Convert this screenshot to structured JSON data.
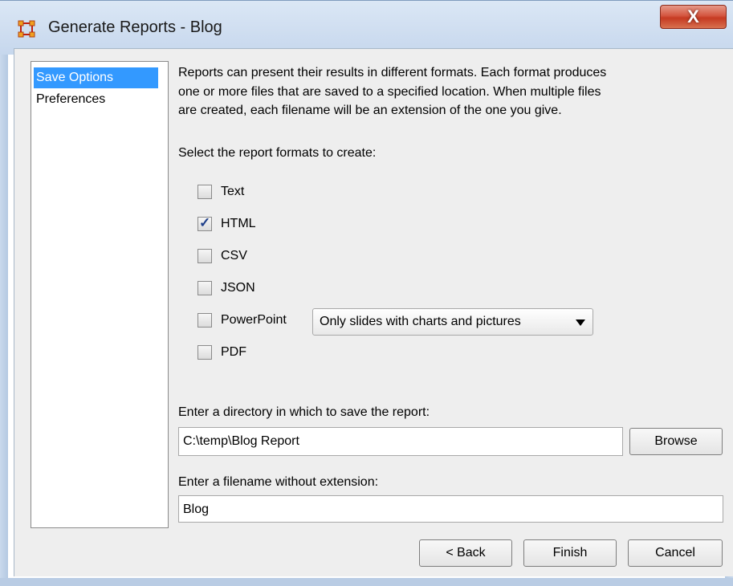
{
  "window": {
    "title": "Generate Reports - Blog",
    "close_label": "X"
  },
  "sidebar": {
    "items": [
      {
        "label": "Save Options",
        "selected": true
      },
      {
        "label": "Preferences",
        "selected": false
      }
    ]
  },
  "main": {
    "description_lines": [
      "Reports can present their results in different formats. Each format produces",
      "one or more files that are saved to a specified location. When multiple files",
      "are created, each filename will be an extension of the one you give."
    ],
    "formats_prompt": "Select the report formats to create:",
    "formats": [
      {
        "label": "Text",
        "checked": false
      },
      {
        "label": "HTML",
        "checked": true
      },
      {
        "label": "CSV",
        "checked": false
      },
      {
        "label": "JSON",
        "checked": false
      },
      {
        "label": "PowerPoint",
        "checked": false
      },
      {
        "label": "PDF",
        "checked": false
      }
    ],
    "powerpoint_option": "Only slides with charts and pictures",
    "directory_prompt": "Enter a directory in which to save the report:",
    "directory_value": "C:\\temp\\Blog Report",
    "browse_label": "Browse",
    "filename_prompt": "Enter a filename without extension:",
    "filename_value": "Blog"
  },
  "footer": {
    "back_label": "< Back",
    "finish_label": "Finish",
    "cancel_label": "Cancel"
  },
  "colors": {
    "selection": "#3399ff",
    "close_button": "#c53a22",
    "panel_bg": "#eeeeee"
  }
}
